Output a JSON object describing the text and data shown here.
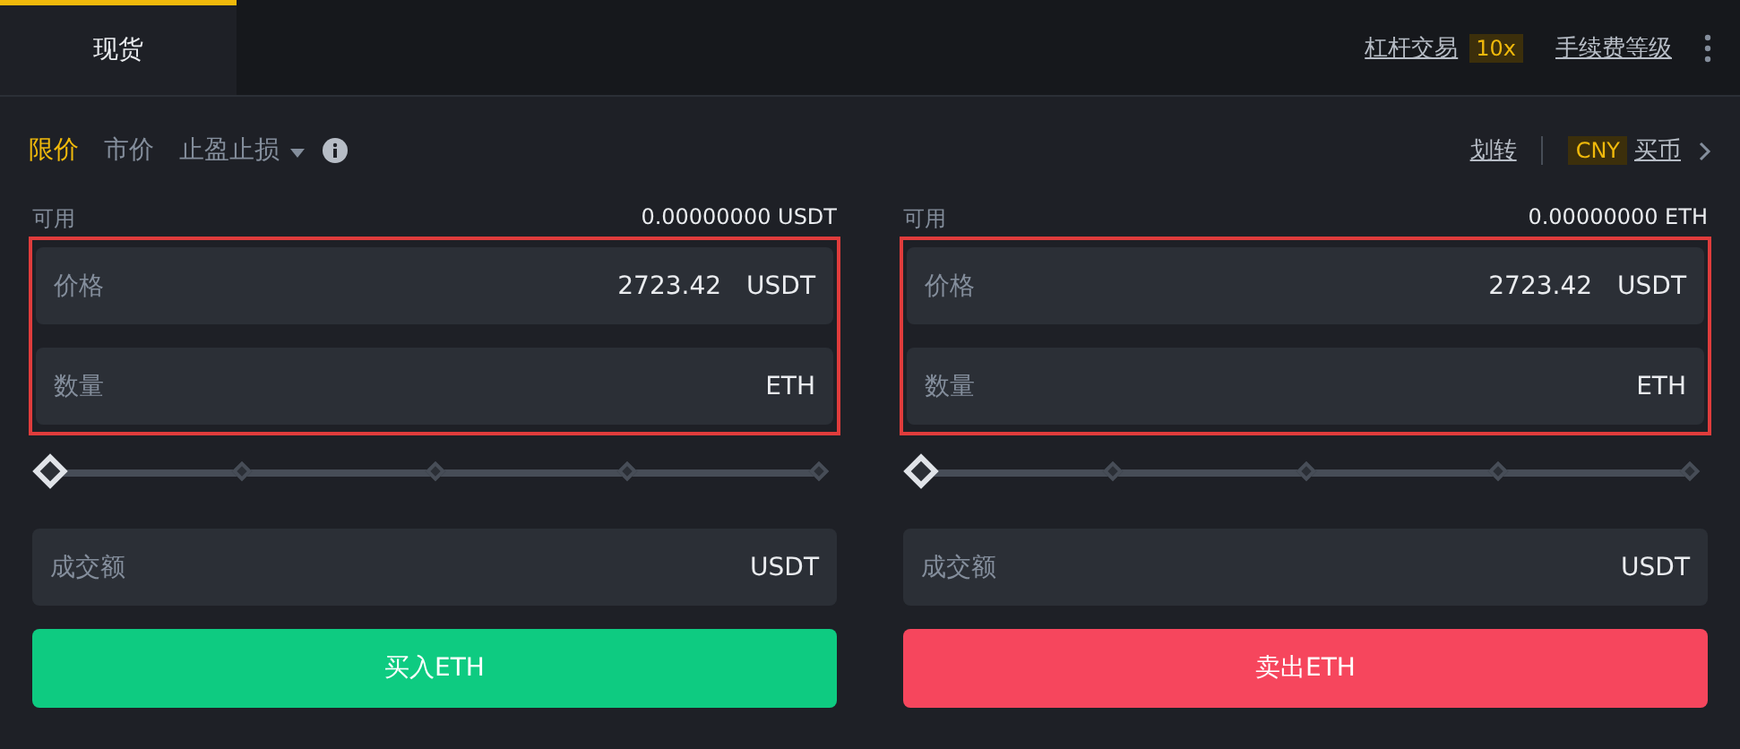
{
  "top_tabs": [
    {
      "label": "现货",
      "selected": true
    }
  ],
  "top_links": [
    {
      "label": "杠杆交易",
      "badge": "10x"
    },
    {
      "label": "手续费等级"
    }
  ],
  "order_types": [
    {
      "label": "限价",
      "selected": true,
      "kind": "plain"
    },
    {
      "label": "市价",
      "selected": false,
      "kind": "plain"
    },
    {
      "label": "止盈止损",
      "selected": false,
      "kind": "dropdown"
    }
  ],
  "transfer_link": "划转",
  "currency_badge": "CNY",
  "buy_crypto_link": "买币",
  "panels": [
    {
      "highlighted": true,
      "available_label": "可用",
      "available_value": "0.00000000 USDT",
      "price": {
        "label": "价格",
        "value": "2723.42",
        "unit": "USDT"
      },
      "amount": {
        "label": "数量",
        "unit": "ETH"
      },
      "slider": {
        "level": 0
      },
      "total": {
        "label": "成交额",
        "unit": "USDT"
      },
      "submit_button": {
        "label": "买入ETH",
        "kind": "buy"
      }
    },
    {
      "highlighted": true,
      "available_label": "可用",
      "available_value": "0.00000000 ETH",
      "price": {
        "label": "价格",
        "value": "2723.42",
        "unit": "USDT"
      },
      "amount": {
        "label": "数量",
        "unit": "ETH"
      },
      "slider": {
        "level": 0
      },
      "total": {
        "label": "成交额",
        "unit": "USDT"
      },
      "submit_button": {
        "label": "卖出ETH",
        "kind": "sell"
      }
    }
  ]
}
